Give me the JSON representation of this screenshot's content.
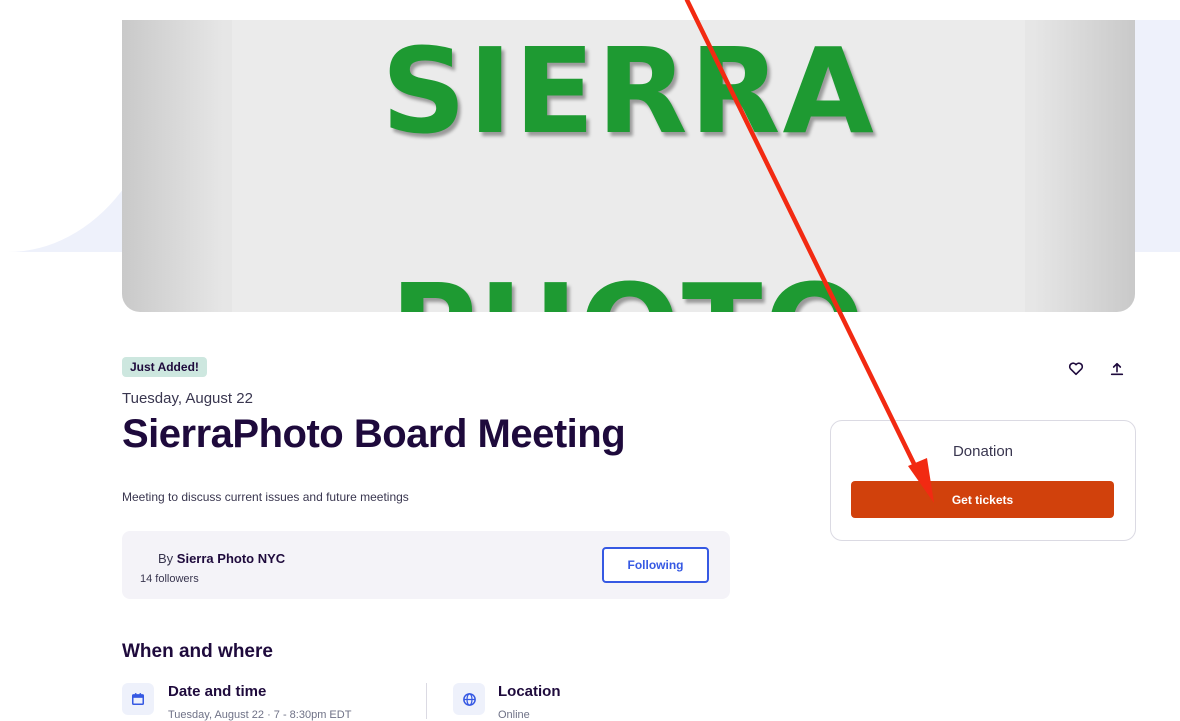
{
  "hero": {
    "line1": "SIERRA",
    "line2": "PHOTO"
  },
  "badge": "Just Added!",
  "actions": {
    "like_icon": "heart-icon",
    "share_icon": "share-icon"
  },
  "event": {
    "date": "Tuesday, August 22",
    "title": "SierraPhoto Board Meeting",
    "summary": "Meeting to discuss current issues and future meetings"
  },
  "organizer": {
    "by_prefix": "By",
    "name": "Sierra Photo NYC",
    "followers": "14 followers",
    "follow_label": "Following"
  },
  "when_where": {
    "title": "When and where",
    "date_time": {
      "label": "Date and time",
      "value": "Tuesday, August 22 · 7 - 8:30pm EDT",
      "icon": "calendar-icon"
    },
    "location": {
      "label": "Location",
      "value": "Online",
      "icon": "globe-icon"
    }
  },
  "tickets": {
    "type_label": "Donation",
    "button_label": "Get tickets",
    "button_color": "#d1410c"
  },
  "annotation": {
    "arrow_color": "#f22a12",
    "icon": "red-arrow-annotation"
  },
  "colors": {
    "brand_blue": "#3659e3",
    "title_ink": "#1e0a3c",
    "badge_bg": "#cde7df"
  }
}
